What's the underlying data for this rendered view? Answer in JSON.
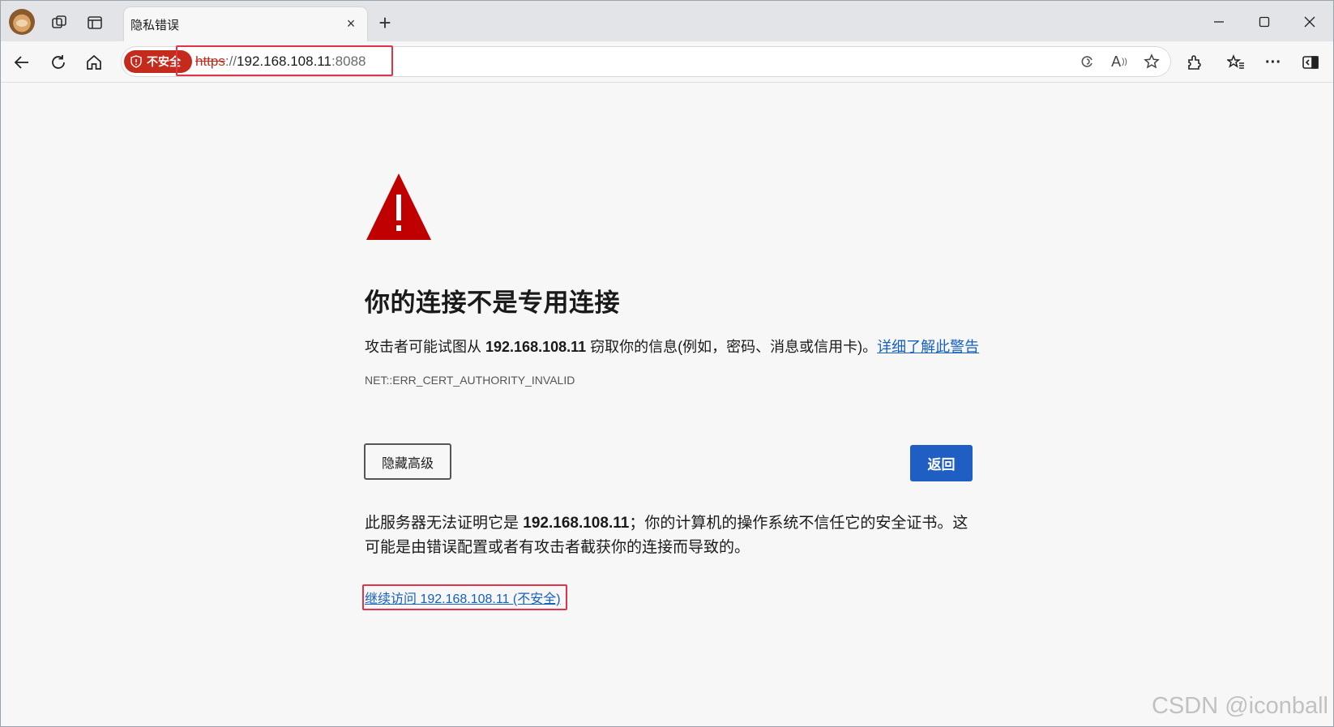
{
  "tab": {
    "title": "隐私错误",
    "close": "×",
    "new_tab": "+"
  },
  "window_controls": {
    "minimize": "—",
    "maximize": "☐",
    "close": "✕"
  },
  "address_bar": {
    "security_label": "不安全",
    "url_scheme": "https",
    "url_sep": "://",
    "url_host": "192.168.108.11",
    "url_port": ":8088"
  },
  "icons": {
    "back": "back-arrow-icon",
    "refresh": "refresh-icon",
    "home": "home-icon",
    "read_aloud_text": "A",
    "more": "···"
  },
  "page": {
    "heading": "你的连接不是专用连接",
    "desc_prefix": "攻击者可能试图从 ",
    "desc_host": "192.168.108.11",
    "desc_suffix": " 窃取你的信息(例如，密码、消息或信用卡)。",
    "desc_link": "详细了解此警告",
    "error_code": "NET::ERR_CERT_AUTHORITY_INVALID",
    "hide_advanced_button": "隐藏高级",
    "back_button": "返回",
    "detail_prefix": "此服务器无法证明它是 ",
    "detail_host": "192.168.108.11",
    "detail_suffix": "；你的计算机的操作系统不信任它的安全证书。这可能是由错误配置或者有攻击者截获你的连接而导致的。",
    "proceed_link": "继续访问 192.168.108.11 (不安全)"
  },
  "watermark": "CSDN @iconball",
  "colors": {
    "danger": "#c42b1c",
    "link": "#1560bd",
    "primary_button": "#1f5fc3",
    "highlight_box": "#e2334a"
  }
}
